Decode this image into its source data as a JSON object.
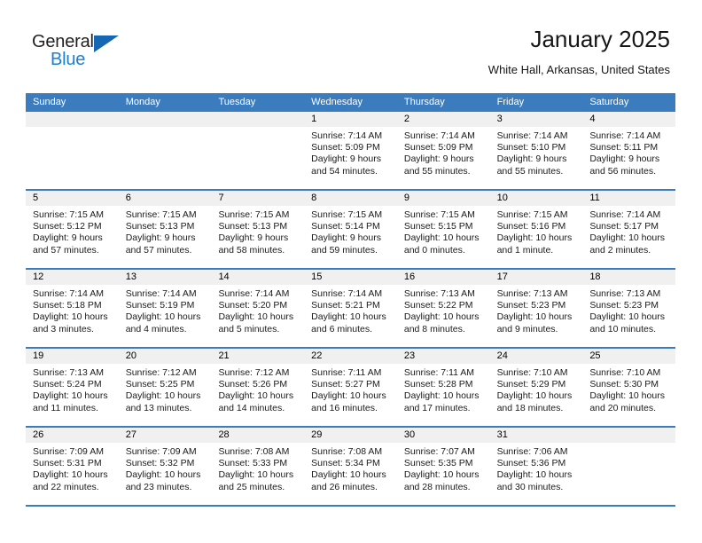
{
  "brand": {
    "name_part1": "General",
    "name_part2": "Blue"
  },
  "header": {
    "month_title": "January 2025",
    "location": "White Hall, Arkansas, United States"
  },
  "colors": {
    "header_blue": "#3b7cbf",
    "logo_blue": "#1b7fd4",
    "day_band_gray": "#f0f0f0"
  },
  "weekdays": [
    "Sunday",
    "Monday",
    "Tuesday",
    "Wednesday",
    "Thursday",
    "Friday",
    "Saturday"
  ],
  "weeks": [
    [
      {
        "day": "",
        "sunrise": "",
        "sunset": "",
        "daylight_line1": "",
        "daylight_line2": "",
        "empty": true
      },
      {
        "day": "",
        "sunrise": "",
        "sunset": "",
        "daylight_line1": "",
        "daylight_line2": "",
        "empty": true
      },
      {
        "day": "",
        "sunrise": "",
        "sunset": "",
        "daylight_line1": "",
        "daylight_line2": "",
        "empty": true
      },
      {
        "day": "1",
        "sunrise": "Sunrise: 7:14 AM",
        "sunset": "Sunset: 5:09 PM",
        "daylight_line1": "Daylight: 9 hours",
        "daylight_line2": "and 54 minutes."
      },
      {
        "day": "2",
        "sunrise": "Sunrise: 7:14 AM",
        "sunset": "Sunset: 5:09 PM",
        "daylight_line1": "Daylight: 9 hours",
        "daylight_line2": "and 55 minutes."
      },
      {
        "day": "3",
        "sunrise": "Sunrise: 7:14 AM",
        "sunset": "Sunset: 5:10 PM",
        "daylight_line1": "Daylight: 9 hours",
        "daylight_line2": "and 55 minutes."
      },
      {
        "day": "4",
        "sunrise": "Sunrise: 7:14 AM",
        "sunset": "Sunset: 5:11 PM",
        "daylight_line1": "Daylight: 9 hours",
        "daylight_line2": "and 56 minutes."
      }
    ],
    [
      {
        "day": "5",
        "sunrise": "Sunrise: 7:15 AM",
        "sunset": "Sunset: 5:12 PM",
        "daylight_line1": "Daylight: 9 hours",
        "daylight_line2": "and 57 minutes."
      },
      {
        "day": "6",
        "sunrise": "Sunrise: 7:15 AM",
        "sunset": "Sunset: 5:13 PM",
        "daylight_line1": "Daylight: 9 hours",
        "daylight_line2": "and 57 minutes."
      },
      {
        "day": "7",
        "sunrise": "Sunrise: 7:15 AM",
        "sunset": "Sunset: 5:13 PM",
        "daylight_line1": "Daylight: 9 hours",
        "daylight_line2": "and 58 minutes."
      },
      {
        "day": "8",
        "sunrise": "Sunrise: 7:15 AM",
        "sunset": "Sunset: 5:14 PM",
        "daylight_line1": "Daylight: 9 hours",
        "daylight_line2": "and 59 minutes."
      },
      {
        "day": "9",
        "sunrise": "Sunrise: 7:15 AM",
        "sunset": "Sunset: 5:15 PM",
        "daylight_line1": "Daylight: 10 hours",
        "daylight_line2": "and 0 minutes."
      },
      {
        "day": "10",
        "sunrise": "Sunrise: 7:15 AM",
        "sunset": "Sunset: 5:16 PM",
        "daylight_line1": "Daylight: 10 hours",
        "daylight_line2": "and 1 minute."
      },
      {
        "day": "11",
        "sunrise": "Sunrise: 7:14 AM",
        "sunset": "Sunset: 5:17 PM",
        "daylight_line1": "Daylight: 10 hours",
        "daylight_line2": "and 2 minutes."
      }
    ],
    [
      {
        "day": "12",
        "sunrise": "Sunrise: 7:14 AM",
        "sunset": "Sunset: 5:18 PM",
        "daylight_line1": "Daylight: 10 hours",
        "daylight_line2": "and 3 minutes."
      },
      {
        "day": "13",
        "sunrise": "Sunrise: 7:14 AM",
        "sunset": "Sunset: 5:19 PM",
        "daylight_line1": "Daylight: 10 hours",
        "daylight_line2": "and 4 minutes."
      },
      {
        "day": "14",
        "sunrise": "Sunrise: 7:14 AM",
        "sunset": "Sunset: 5:20 PM",
        "daylight_line1": "Daylight: 10 hours",
        "daylight_line2": "and 5 minutes."
      },
      {
        "day": "15",
        "sunrise": "Sunrise: 7:14 AM",
        "sunset": "Sunset: 5:21 PM",
        "daylight_line1": "Daylight: 10 hours",
        "daylight_line2": "and 6 minutes."
      },
      {
        "day": "16",
        "sunrise": "Sunrise: 7:13 AM",
        "sunset": "Sunset: 5:22 PM",
        "daylight_line1": "Daylight: 10 hours",
        "daylight_line2": "and 8 minutes."
      },
      {
        "day": "17",
        "sunrise": "Sunrise: 7:13 AM",
        "sunset": "Sunset: 5:23 PM",
        "daylight_line1": "Daylight: 10 hours",
        "daylight_line2": "and 9 minutes."
      },
      {
        "day": "18",
        "sunrise": "Sunrise: 7:13 AM",
        "sunset": "Sunset: 5:23 PM",
        "daylight_line1": "Daylight: 10 hours",
        "daylight_line2": "and 10 minutes."
      }
    ],
    [
      {
        "day": "19",
        "sunrise": "Sunrise: 7:13 AM",
        "sunset": "Sunset: 5:24 PM",
        "daylight_line1": "Daylight: 10 hours",
        "daylight_line2": "and 11 minutes."
      },
      {
        "day": "20",
        "sunrise": "Sunrise: 7:12 AM",
        "sunset": "Sunset: 5:25 PM",
        "daylight_line1": "Daylight: 10 hours",
        "daylight_line2": "and 13 minutes."
      },
      {
        "day": "21",
        "sunrise": "Sunrise: 7:12 AM",
        "sunset": "Sunset: 5:26 PM",
        "daylight_line1": "Daylight: 10 hours",
        "daylight_line2": "and 14 minutes."
      },
      {
        "day": "22",
        "sunrise": "Sunrise: 7:11 AM",
        "sunset": "Sunset: 5:27 PM",
        "daylight_line1": "Daylight: 10 hours",
        "daylight_line2": "and 16 minutes."
      },
      {
        "day": "23",
        "sunrise": "Sunrise: 7:11 AM",
        "sunset": "Sunset: 5:28 PM",
        "daylight_line1": "Daylight: 10 hours",
        "daylight_line2": "and 17 minutes."
      },
      {
        "day": "24",
        "sunrise": "Sunrise: 7:10 AM",
        "sunset": "Sunset: 5:29 PM",
        "daylight_line1": "Daylight: 10 hours",
        "daylight_line2": "and 18 minutes."
      },
      {
        "day": "25",
        "sunrise": "Sunrise: 7:10 AM",
        "sunset": "Sunset: 5:30 PM",
        "daylight_line1": "Daylight: 10 hours",
        "daylight_line2": "and 20 minutes."
      }
    ],
    [
      {
        "day": "26",
        "sunrise": "Sunrise: 7:09 AM",
        "sunset": "Sunset: 5:31 PM",
        "daylight_line1": "Daylight: 10 hours",
        "daylight_line2": "and 22 minutes."
      },
      {
        "day": "27",
        "sunrise": "Sunrise: 7:09 AM",
        "sunset": "Sunset: 5:32 PM",
        "daylight_line1": "Daylight: 10 hours",
        "daylight_line2": "and 23 minutes."
      },
      {
        "day": "28",
        "sunrise": "Sunrise: 7:08 AM",
        "sunset": "Sunset: 5:33 PM",
        "daylight_line1": "Daylight: 10 hours",
        "daylight_line2": "and 25 minutes."
      },
      {
        "day": "29",
        "sunrise": "Sunrise: 7:08 AM",
        "sunset": "Sunset: 5:34 PM",
        "daylight_line1": "Daylight: 10 hours",
        "daylight_line2": "and 26 minutes."
      },
      {
        "day": "30",
        "sunrise": "Sunrise: 7:07 AM",
        "sunset": "Sunset: 5:35 PM",
        "daylight_line1": "Daylight: 10 hours",
        "daylight_line2": "and 28 minutes."
      },
      {
        "day": "31",
        "sunrise": "Sunrise: 7:06 AM",
        "sunset": "Sunset: 5:36 PM",
        "daylight_line1": "Daylight: 10 hours",
        "daylight_line2": "and 30 minutes."
      },
      {
        "day": "",
        "sunrise": "",
        "sunset": "",
        "daylight_line1": "",
        "daylight_line2": "",
        "empty": true
      }
    ]
  ]
}
